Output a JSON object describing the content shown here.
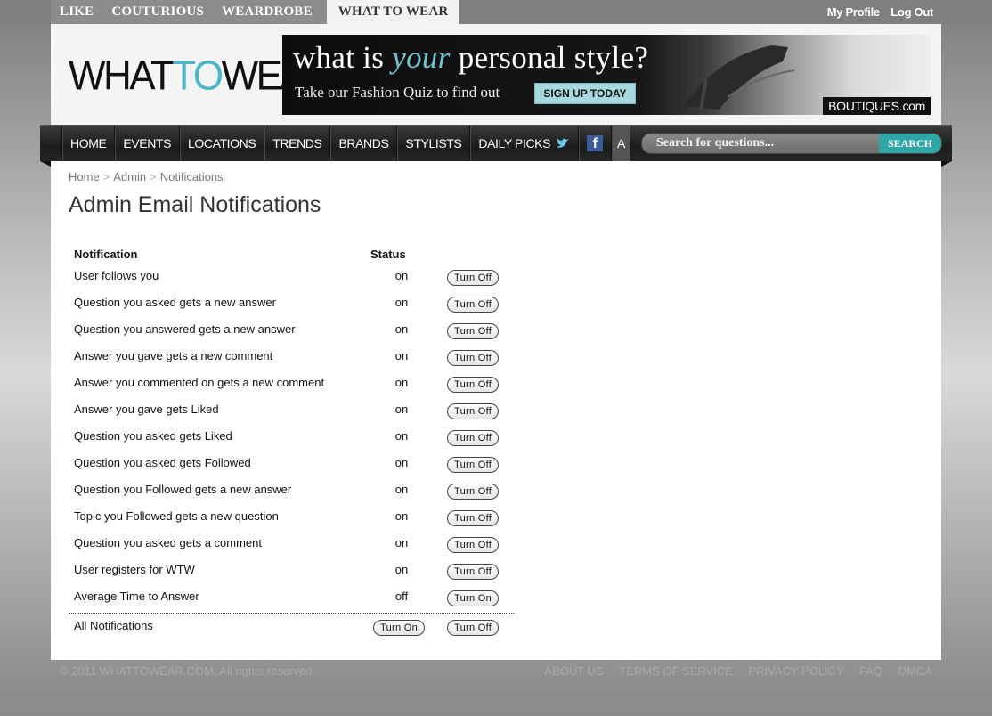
{
  "top_nav": {
    "site_links": [
      "LIKE",
      "COUTURIOUS",
      "WEARDROBE",
      "WHAT TO WEAR"
    ],
    "active_site": "WHAT TO WEAR",
    "my_profile": "My Profile",
    "log_out": "Log Out"
  },
  "header": {
    "logo_what": "WHAT",
    "logo_to": "TO",
    "logo_wear": "WEAR",
    "banner_tag_pre": "what is ",
    "banner_tag_em": "your",
    "banner_tag_post": " personal style?",
    "banner_sub": "Take our Fashion Quiz to find out",
    "banner_signup": "SIGN UP TODAY",
    "banner_boutiques": "BOUTIQUES.com"
  },
  "nav": {
    "items": [
      "HOME",
      "EVENTS",
      "LOCATIONS",
      "TRENDS",
      "BRANDS",
      "STYLISTS",
      "DAILY PICKS"
    ],
    "facebook_letter": "f",
    "extra": "A",
    "search_placeholder": "Search for questions...",
    "search_button": "SEARCH"
  },
  "breadcrumb": {
    "home": "Home",
    "sep": ">",
    "admin": "Admin",
    "current": "Notifications"
  },
  "page_title": "Admin Email Notifications",
  "table": {
    "col_notification": "Notification",
    "col_status": "Status",
    "rows": [
      {
        "label": "User follows you",
        "status": "on",
        "button": "Turn Off"
      },
      {
        "label": "Question you asked gets a new answer",
        "status": "on",
        "button": "Turn Off"
      },
      {
        "label": "Question you answered gets a new answer",
        "status": "on",
        "button": "Turn Off"
      },
      {
        "label": "Answer you gave gets a new comment",
        "status": "on",
        "button": "Turn Off"
      },
      {
        "label": "Answer you commented on gets a new comment",
        "status": "on",
        "button": "Turn Off"
      },
      {
        "label": "Answer you gave gets Liked",
        "status": "on",
        "button": "Turn Off"
      },
      {
        "label": "Question you asked gets Liked",
        "status": "on",
        "button": "Turn Off"
      },
      {
        "label": "Question you asked gets Followed",
        "status": "on",
        "button": "Turn Off"
      },
      {
        "label": "Question you Followed gets a new answer",
        "status": "on",
        "button": "Turn Off"
      },
      {
        "label": "Topic you Followed gets a new question",
        "status": "on",
        "button": "Turn Off"
      },
      {
        "label": "Question you asked gets a comment",
        "status": "on",
        "button": "Turn Off"
      },
      {
        "label": "User registers for WTW",
        "status": "on",
        "button": "Turn Off"
      },
      {
        "label": "Average Time to Answer",
        "status": "off",
        "button": "Turn On"
      }
    ],
    "all_label": "All Notifications",
    "all_on": "Turn On",
    "all_off": "Turn Off"
  },
  "footer": {
    "copyright": "© 2011 WHATTOWEAR.COM, All rights reserved.",
    "links": [
      "ABOUT US",
      "TERMS OF SERVICE",
      "PRIVACY POLICY",
      "FAQ",
      "DMCA"
    ]
  },
  "colors": {
    "accent_teal": "#4bb6c5",
    "search_button": "#2fa6a6"
  }
}
